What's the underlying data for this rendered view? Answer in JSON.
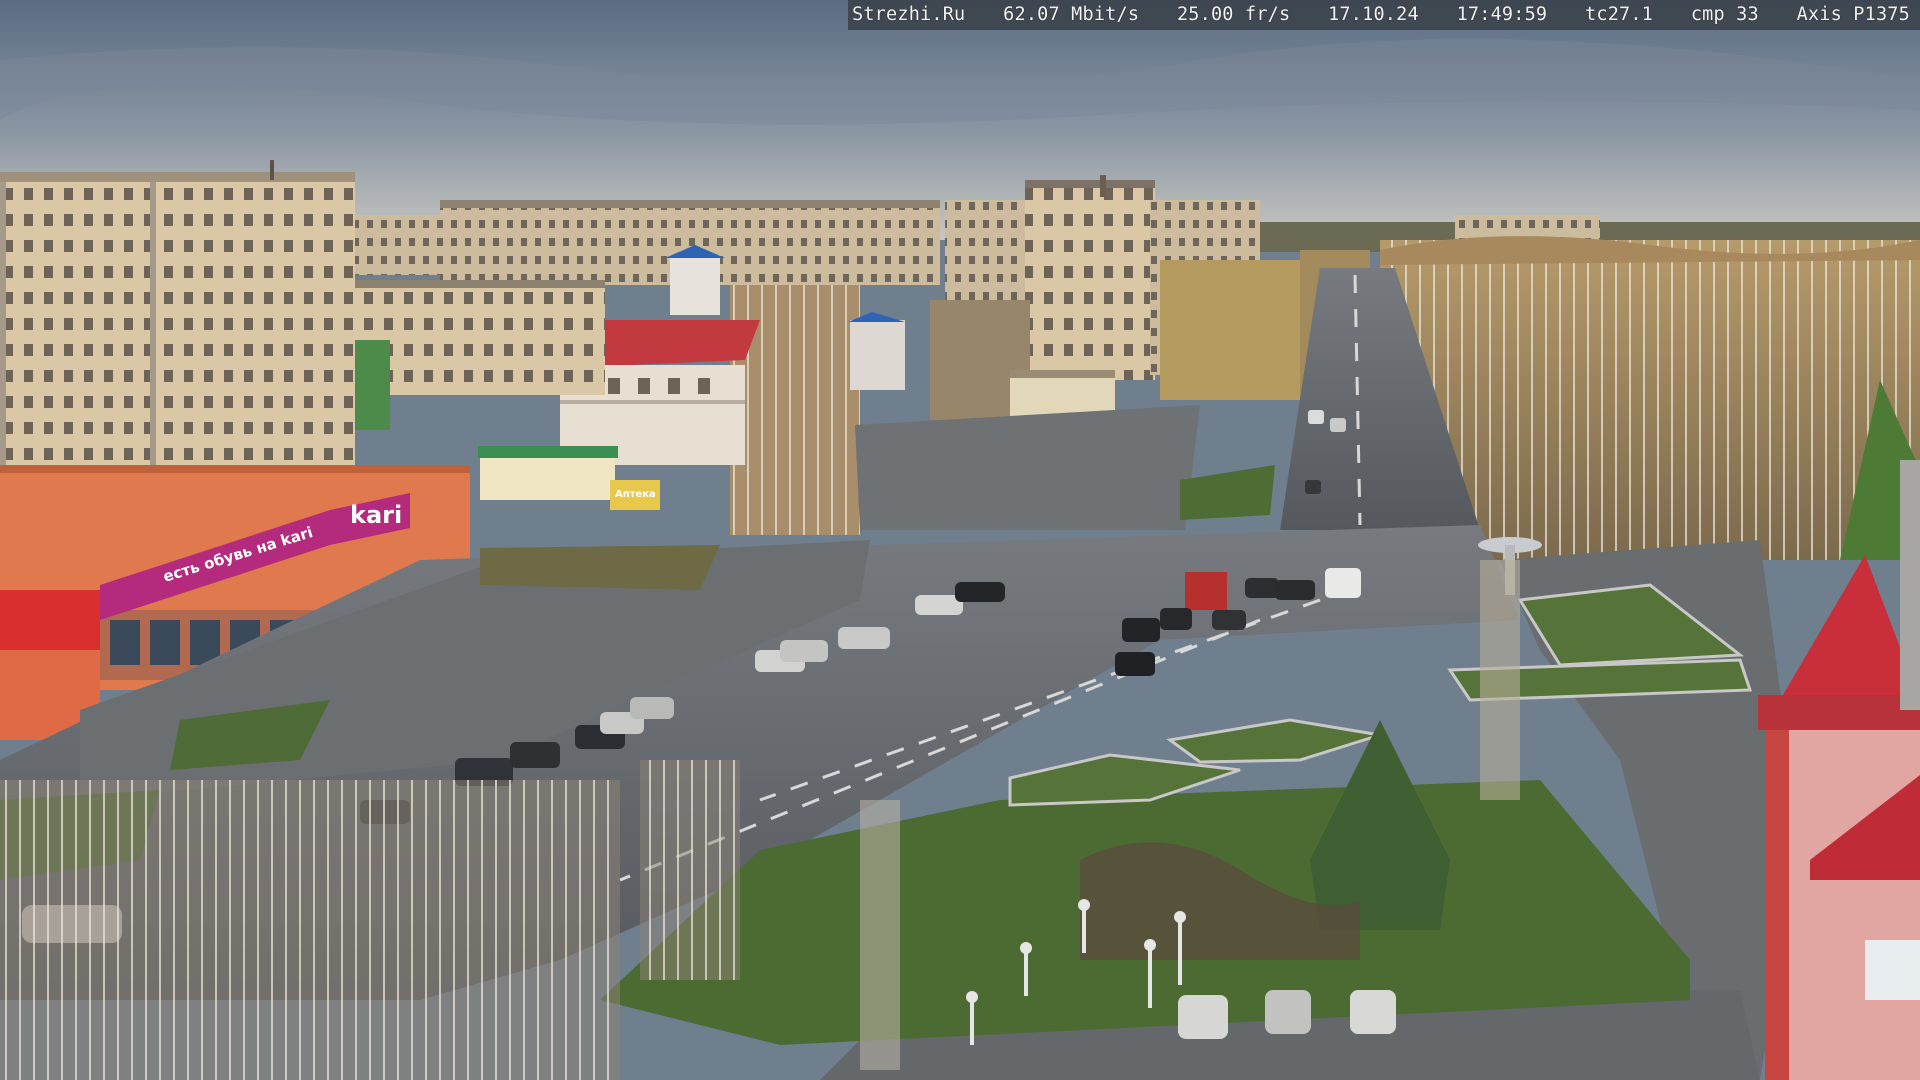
{
  "overlay": {
    "site": "Strezhi.Ru",
    "bitrate": "62.07 Mbit/s",
    "framerate": "25.00 fr/s",
    "date": "17.10.24",
    "time": "17:49:59",
    "tc": "tc27.1",
    "cmp": "cmp 33",
    "camera": "Axis P1375"
  },
  "signs": {
    "store_logo": "kari",
    "store_slogan": "есть обувь на kari",
    "shop_sign": "Аптека"
  },
  "colors": {
    "sky_top": "#5d6f86",
    "sky_bottom": "#c2c5c4",
    "road": "#5f6469",
    "plaza": "#6b6e70",
    "grass": "#4c6b33",
    "orange_building": "#e07a4e",
    "magenta_banner": "#b42a7c",
    "red_roof": "#c92f3a"
  }
}
